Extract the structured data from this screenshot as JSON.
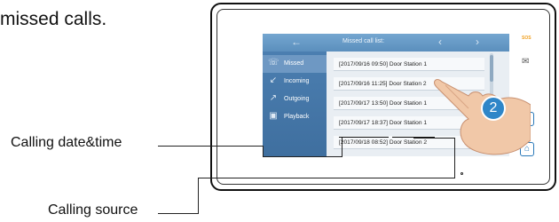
{
  "caption_top": "missed calls.",
  "callouts": {
    "date_time": "Calling date&time",
    "source": "Calling source"
  },
  "screen": {
    "title": "Missed call list:",
    "sidebar": [
      {
        "label": "Missed",
        "icon": "missed-call-icon"
      },
      {
        "label": "Incoming",
        "icon": "incoming-call-icon"
      },
      {
        "label": "Outgoing",
        "icon": "outgoing-call-icon"
      },
      {
        "label": "Playback",
        "icon": "playback-icon"
      }
    ],
    "rows": [
      "[2017/09/16 09:50] Door Station 1",
      "[2017/09/16 11:25] Door Station 2",
      "[2017/09/17 13:50] Door Station 1",
      "[2017/09/17 18:37] Door Station 1",
      "[2017/09/18 08:52] Door Station 2"
    ]
  },
  "device": {
    "led_label": "SOS",
    "step_number": "2"
  },
  "colors": {
    "screen_bg": "#9fc0da",
    "sidebar_bg": "#4b7eb0",
    "accent": "#2a79b9"
  }
}
